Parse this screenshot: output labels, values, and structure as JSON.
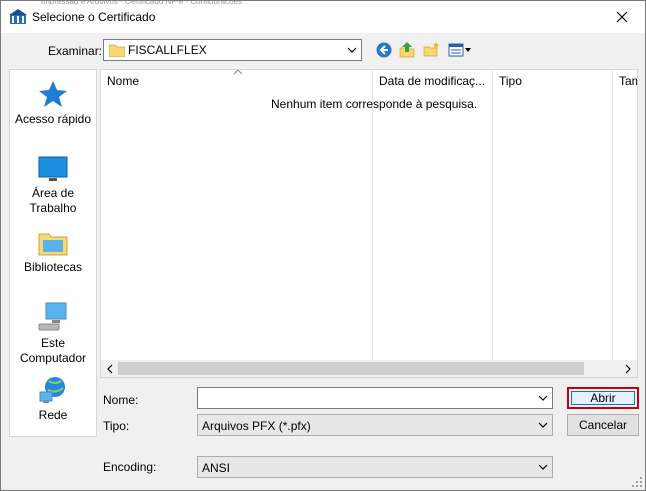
{
  "window": {
    "title": "Selecione o Certificado",
    "background_strip": "Impressao e Arquivos · Certificado NF-e · Configuracoes"
  },
  "toolbar": {
    "look_in_label": "Examinar:",
    "current_folder": "FISCALLFLEX",
    "icons": [
      "back-icon",
      "up-folder-icon",
      "new-folder-icon",
      "view-menu-icon"
    ]
  },
  "places": [
    {
      "label": "Acesso rápido",
      "icon": "star-icon"
    },
    {
      "label": "Área de Trabalho",
      "icon": "desktop-icon"
    },
    {
      "label": "Bibliotecas",
      "icon": "libraries-icon"
    },
    {
      "label": "Este Computador",
      "icon": "computer-icon"
    },
    {
      "label": "Rede",
      "icon": "network-icon"
    }
  ],
  "filelist": {
    "columns": [
      "Nome",
      "Data de modificaç...",
      "Tipo",
      "Tam"
    ],
    "empty_message": "Nenhum item corresponde à pesquisa."
  },
  "form": {
    "name_label": "Nome:",
    "name_value": "",
    "type_label": "Tipo:",
    "type_value": "Arquivos PFX (*.pfx)",
    "encoding_label": "Encoding:",
    "encoding_value": "ANSI"
  },
  "buttons": {
    "open": "Abrir",
    "cancel": "Cancelar"
  },
  "colors": {
    "highlight_border": "#cc0000",
    "accent": "#0078d7",
    "folder_yellow": "#f8d775"
  }
}
